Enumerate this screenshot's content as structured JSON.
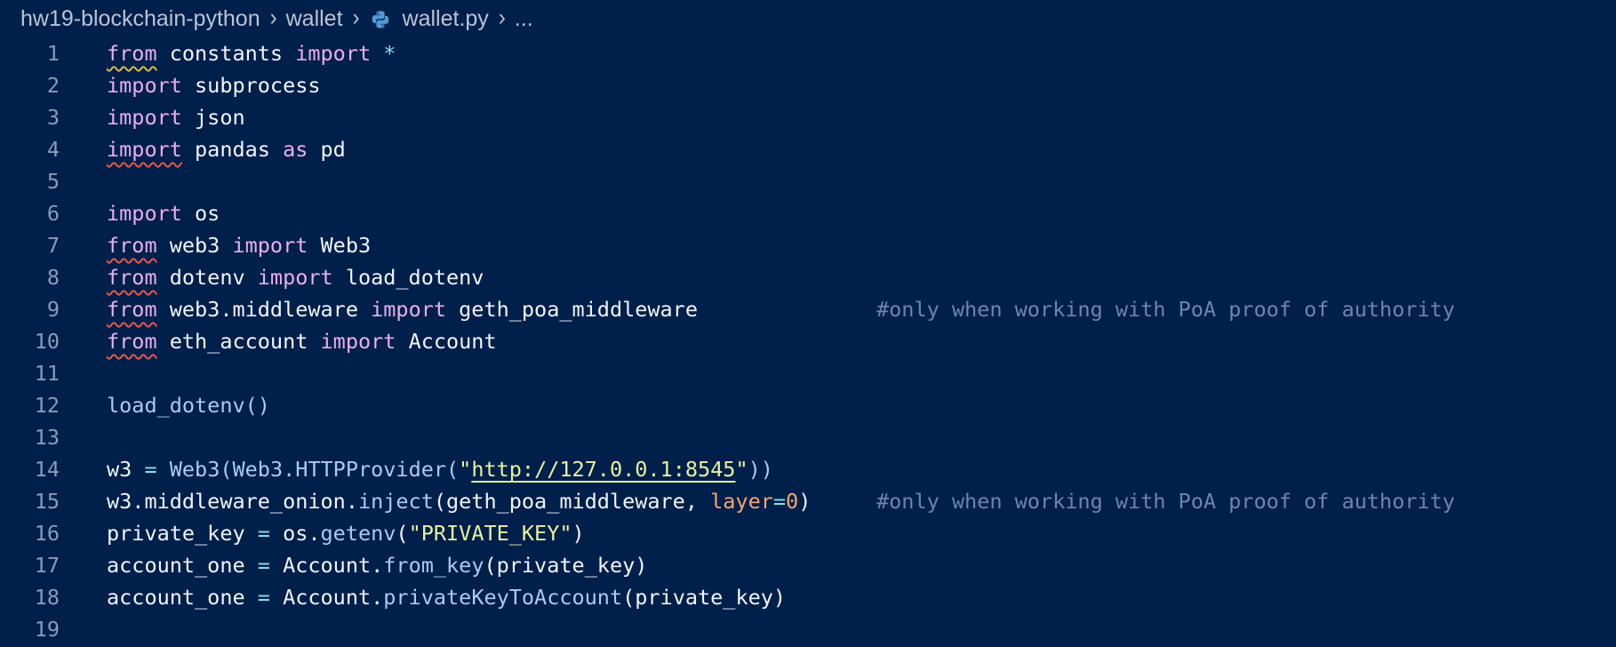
{
  "breadcrumb": {
    "project": "hw19-blockchain-python",
    "folder": "wallet",
    "file": "wallet.py",
    "more": "..."
  },
  "editor": {
    "language_icon": "python-icon",
    "lines": [
      {
        "number": "1",
        "tokens": [
          {
            "t": "from",
            "c": "kw",
            "u": "y"
          },
          {
            "t": " constants ",
            "c": "plain"
          },
          {
            "t": "import",
            "c": "kw"
          },
          {
            "t": " *",
            "c": "op"
          }
        ]
      },
      {
        "number": "2",
        "tokens": [
          {
            "t": "import",
            "c": "kw"
          },
          {
            "t": " subprocess",
            "c": "plain"
          }
        ]
      },
      {
        "number": "3",
        "tokens": [
          {
            "t": "import",
            "c": "kw"
          },
          {
            "t": " json",
            "c": "plain"
          }
        ]
      },
      {
        "number": "4",
        "tokens": [
          {
            "t": "import",
            "c": "kw",
            "u": "r"
          },
          {
            "t": " pandas ",
            "c": "plain"
          },
          {
            "t": "as",
            "c": "kw"
          },
          {
            "t": " pd",
            "c": "plain"
          }
        ]
      },
      {
        "number": "5",
        "tokens": []
      },
      {
        "number": "6",
        "tokens": [
          {
            "t": "import",
            "c": "kw"
          },
          {
            "t": " os",
            "c": "plain"
          }
        ]
      },
      {
        "number": "7",
        "tokens": [
          {
            "t": "from",
            "c": "kw",
            "u": "r"
          },
          {
            "t": " web3 ",
            "c": "plain"
          },
          {
            "t": "import",
            "c": "kw"
          },
          {
            "t": " Web3",
            "c": "plain"
          }
        ]
      },
      {
        "number": "8",
        "tokens": [
          {
            "t": "from",
            "c": "kw",
            "u": "r"
          },
          {
            "t": " dotenv ",
            "c": "plain"
          },
          {
            "t": "import",
            "c": "kw"
          },
          {
            "t": " load_dotenv",
            "c": "plain"
          }
        ]
      },
      {
        "number": "9",
        "tokens": [
          {
            "t": "from",
            "c": "kw",
            "u": "r"
          },
          {
            "t": " web3.middleware ",
            "c": "plain"
          },
          {
            "t": "import",
            "c": "kw"
          },
          {
            "t": " geth_poa_middleware",
            "c": "plain"
          }
        ],
        "comment": "#only when working with PoA proof of authority"
      },
      {
        "number": "10",
        "tokens": [
          {
            "t": "from",
            "c": "kw",
            "u": "r"
          },
          {
            "t": " eth_account ",
            "c": "plain"
          },
          {
            "t": "import",
            "c": "kw"
          },
          {
            "t": " Account",
            "c": "plain"
          }
        ]
      },
      {
        "number": "11",
        "tokens": []
      },
      {
        "number": "12",
        "tokens": [
          {
            "t": "load_dotenv()",
            "c": "fn"
          }
        ]
      },
      {
        "number": "13",
        "tokens": []
      },
      {
        "number": "14",
        "tokens": [
          {
            "t": "w3 ",
            "c": "plain"
          },
          {
            "t": "=",
            "c": "op"
          },
          {
            "t": " Web3(Web3.HTTPProvider(",
            "c": "fn"
          },
          {
            "t": "\"",
            "c": "str"
          },
          {
            "t": "http://127.0.0.1:8545",
            "c": "str",
            "u": "url"
          },
          {
            "t": "\"",
            "c": "str"
          },
          {
            "t": "))",
            "c": "fn"
          }
        ]
      },
      {
        "number": "15",
        "tokens": [
          {
            "t": "w3.middleware_onion.",
            "c": "plain"
          },
          {
            "t": "inject",
            "c": "fn"
          },
          {
            "t": "(geth_poa_middleware, ",
            "c": "plain"
          },
          {
            "t": "layer",
            "c": "param"
          },
          {
            "t": "=",
            "c": "op"
          },
          {
            "t": "0",
            "c": "num"
          },
          {
            "t": ")",
            "c": "plain"
          }
        ],
        "comment": "#only when working with PoA proof of authority"
      },
      {
        "number": "16",
        "tokens": [
          {
            "t": "private_key ",
            "c": "plain"
          },
          {
            "t": "=",
            "c": "op"
          },
          {
            "t": " os.",
            "c": "plain"
          },
          {
            "t": "getenv",
            "c": "fn"
          },
          {
            "t": "(",
            "c": "plain"
          },
          {
            "t": "\"PRIVATE_KEY\"",
            "c": "str"
          },
          {
            "t": ")",
            "c": "plain"
          }
        ]
      },
      {
        "number": "17",
        "tokens": [
          {
            "t": "account_one ",
            "c": "plain"
          },
          {
            "t": "=",
            "c": "op"
          },
          {
            "t": " Account.",
            "c": "plain"
          },
          {
            "t": "from_key",
            "c": "fn"
          },
          {
            "t": "(private_key)",
            "c": "plain"
          }
        ]
      },
      {
        "number": "18",
        "tokens": [
          {
            "t": "account_one ",
            "c": "plain"
          },
          {
            "t": "=",
            "c": "op"
          },
          {
            "t": " Account.",
            "c": "plain"
          },
          {
            "t": "privateKeyToAccount",
            "c": "fn"
          },
          {
            "t": "(private_key)",
            "c": "plain"
          }
        ]
      },
      {
        "number": "19",
        "tokens": []
      }
    ]
  },
  "colors": {
    "background": "#011f4b",
    "keyword": "#e6b0e8",
    "string": "#e8f29d",
    "comment": "#6b85b3",
    "function": "#a6ccf7",
    "number": "#f7a46d",
    "line_number": "#8a9bb6"
  }
}
